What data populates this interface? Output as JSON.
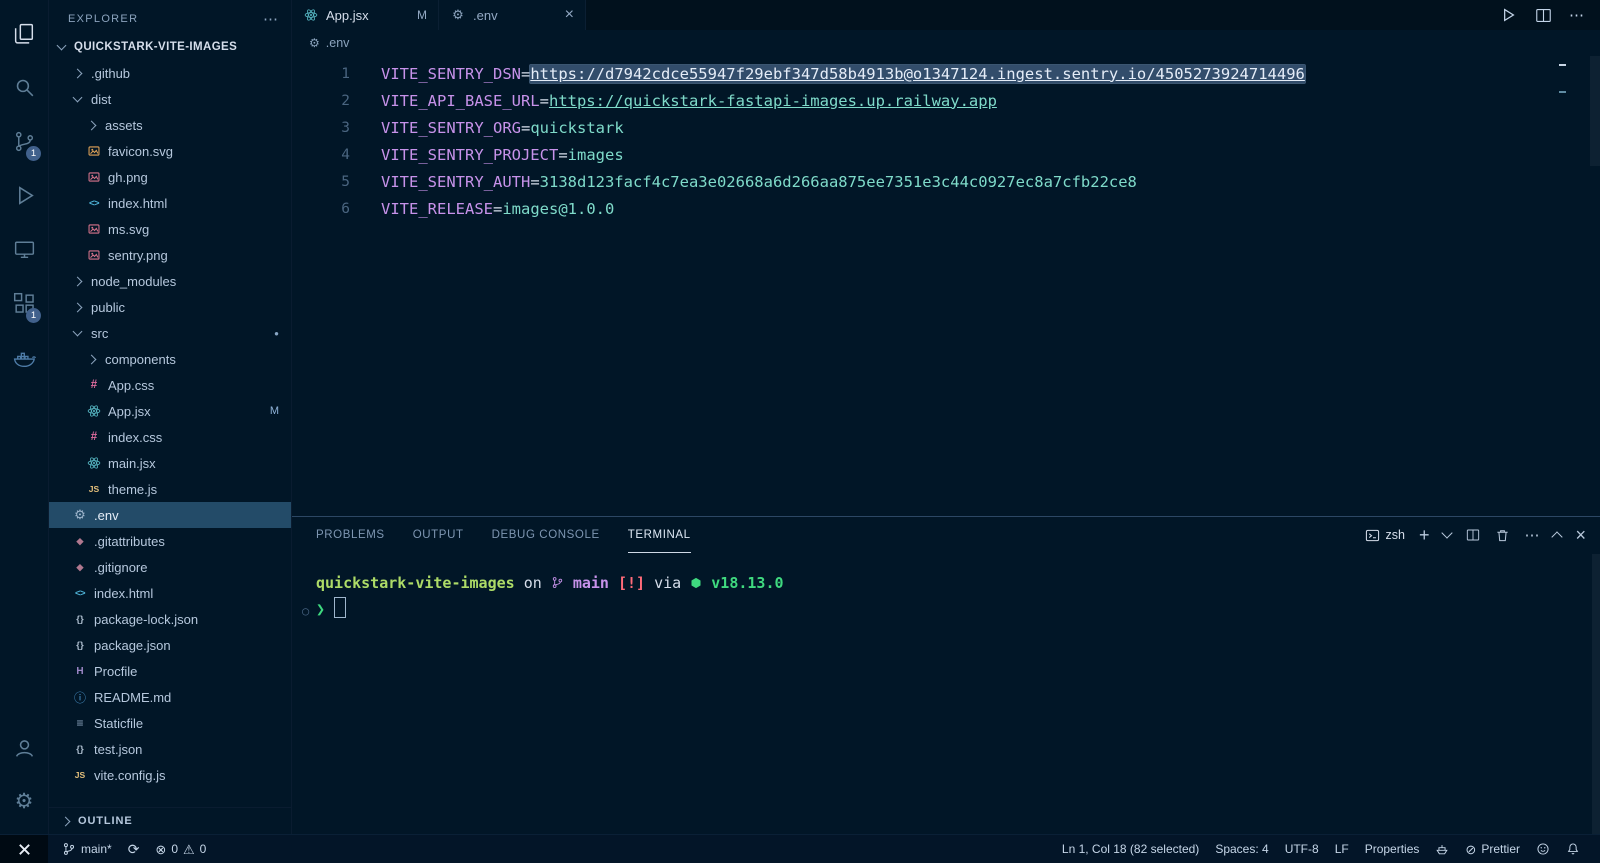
{
  "colors": {
    "background": "#011627",
    "foreground": "#d6deeb",
    "key_purple": "#c792ea",
    "value_teal": "#7fdbca",
    "selection_blue": "#5f7e97",
    "selected_row": "#234b68",
    "terminal_green": "#3fd97f",
    "terminal_yellow": "#addb67",
    "terminal_red": "#ff6b7a",
    "badge_blue": "#41618c"
  },
  "icons": {
    "gear": "⚙",
    "html": "<>",
    "css": "#",
    "js": "JS",
    "json": "{}",
    "git": "◆",
    "heroku": "H",
    "info": "ⓘ",
    "list": "≡",
    "ellipsis": "⋯",
    "close": "×",
    "plus": "+",
    "dot": "●",
    "decoration": "○",
    "prompt": "❯",
    "slash_circle": "⊘",
    "error": "⊗",
    "warning": "⚠",
    "sync": "⟳"
  },
  "activity_bar": {
    "source_control_badge": "1",
    "extensions_badge": "1"
  },
  "sidebar": {
    "header": "EXPLORER",
    "root": "QUICKSTARK-VITE-IMAGES",
    "outline": "OUTLINE",
    "tree": [
      {
        "label": ".github",
        "kind": "folder-collapsed"
      },
      {
        "label": "dist",
        "kind": "folder-expanded"
      },
      {
        "label": "assets",
        "kind": "folder-collapsed"
      },
      {
        "label": "favicon.svg",
        "kind": "image"
      },
      {
        "label": "gh.png",
        "kind": "image"
      },
      {
        "label": "index.html",
        "kind": "html"
      },
      {
        "label": "ms.svg",
        "kind": "image"
      },
      {
        "label": "sentry.png",
        "kind": "image"
      },
      {
        "label": "node_modules",
        "kind": "folder-collapsed"
      },
      {
        "label": "public",
        "kind": "folder-collapsed"
      },
      {
        "label": "src",
        "kind": "folder-expanded",
        "badge": "●"
      },
      {
        "label": "components",
        "kind": "folder-collapsed"
      },
      {
        "label": "App.css",
        "kind": "css"
      },
      {
        "label": "App.jsx",
        "kind": "react",
        "badge": "M"
      },
      {
        "label": "index.css",
        "kind": "css"
      },
      {
        "label": "main.jsx",
        "kind": "react"
      },
      {
        "label": "theme.js",
        "kind": "js"
      },
      {
        "label": ".env",
        "kind": "gear",
        "selected": true
      },
      {
        "label": ".gitattributes",
        "kind": "git"
      },
      {
        "label": ".gitignore",
        "kind": "git"
      },
      {
        "label": "index.html",
        "kind": "html"
      },
      {
        "label": "package-lock.json",
        "kind": "json"
      },
      {
        "label": "package.json",
        "kind": "json"
      },
      {
        "label": "Procfile",
        "kind": "heroku"
      },
      {
        "label": "README.md",
        "kind": "info"
      },
      {
        "label": "Staticfile",
        "kind": "list"
      },
      {
        "label": "test.json",
        "kind": "json"
      },
      {
        "label": "vite.config.js",
        "kind": "js"
      }
    ]
  },
  "tabs": {
    "tab1": {
      "label": "App.jsx",
      "badge": "M"
    },
    "tab2": {
      "label": ".env"
    }
  },
  "breadcrumb": {
    "label": ".env"
  },
  "editor": {
    "lines": [
      {
        "num": "1",
        "key": "VITE_SENTRY_DSN",
        "eq": "=",
        "value": "https://d7942cdce55947f29ebf347d58b4913b@o1347124.ingest.sentry.io/4505273924714496"
      },
      {
        "num": "2",
        "key": "VITE_API_BASE_URL",
        "eq": "=",
        "value": "https://quickstark-fastapi-images.up.railway.app"
      },
      {
        "num": "3",
        "key": "VITE_SENTRY_ORG",
        "eq": "=",
        "value": "quickstark"
      },
      {
        "num": "4",
        "key": "VITE_SENTRY_PROJECT",
        "eq": "=",
        "value": "images"
      },
      {
        "num": "5",
        "key": "VITE_SENTRY_AUTH",
        "eq": "=",
        "value": "3138d123facf4c7ea3e02668a6d266aa875ee7351e3c44c0927ec8a7cfb22ce8"
      },
      {
        "num": "6",
        "key": "VITE_RELEASE",
        "eq": "=",
        "value": "images@1.0.0"
      }
    ]
  },
  "panel": {
    "tabs": [
      "PROBLEMS",
      "OUTPUT",
      "DEBUG CONSOLE",
      "TERMINAL"
    ],
    "shell": "zsh"
  },
  "terminal": {
    "line1": {
      "repo": "quickstark-vite-images",
      "on": " on ",
      "branch": "main",
      "dirty": " [!]",
      "via": " via ",
      "node": " v18.13.0"
    },
    "prompt_symbol": "❯",
    "decoration": "○"
  },
  "status_bar": {
    "branch": "main*",
    "errors": "0",
    "warnings": "0",
    "cursor": "Ln 1, Col 18 (82 selected)",
    "indent": "Spaces: 4",
    "encoding": "UTF-8",
    "eol": "LF",
    "language": "Properties",
    "formatter": "Prettier"
  }
}
